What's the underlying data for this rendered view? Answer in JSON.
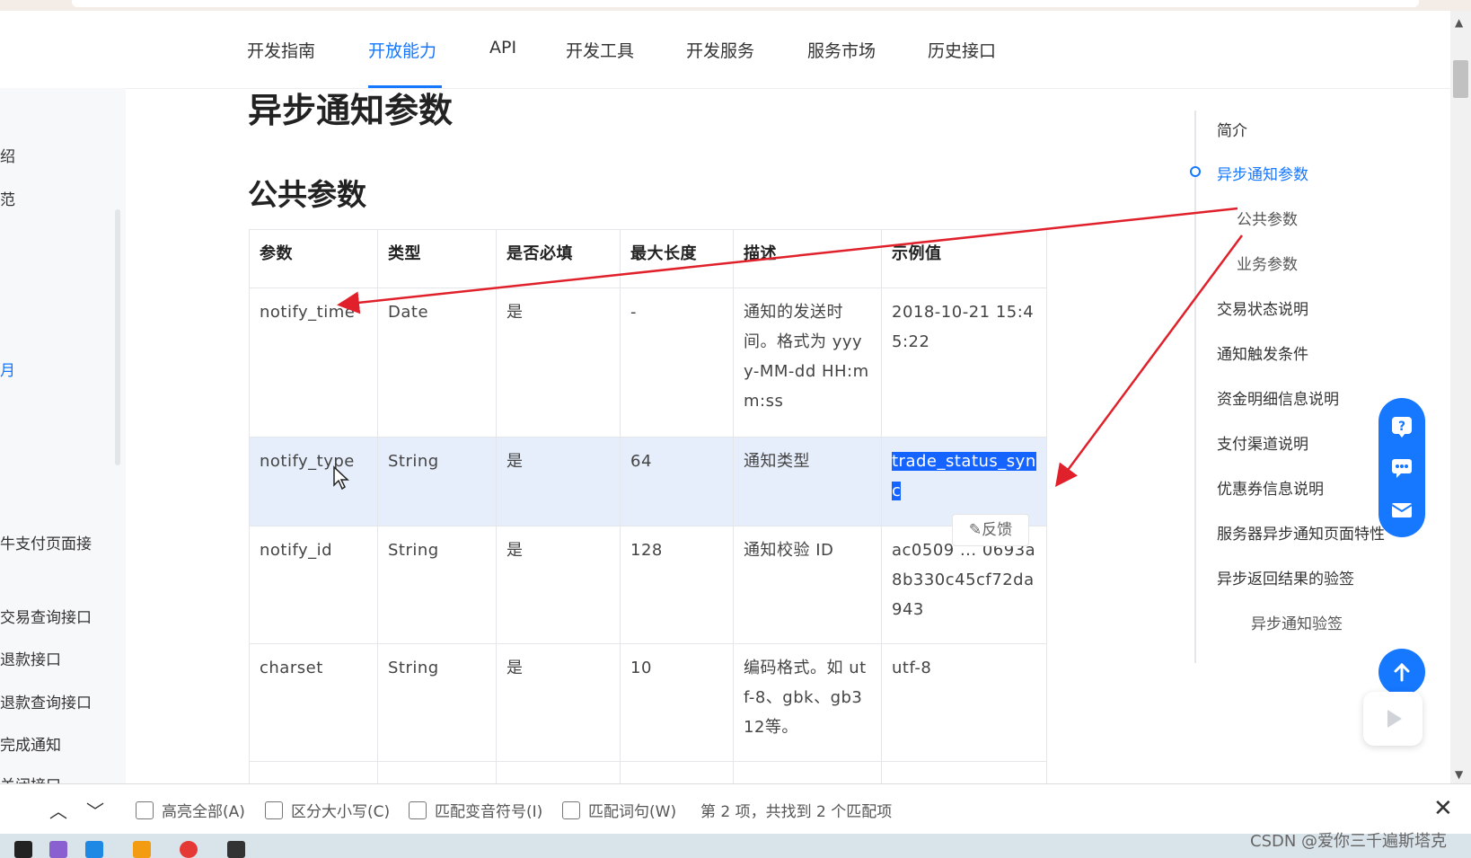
{
  "nav": {
    "items": [
      {
        "label": "开发指南",
        "active": false
      },
      {
        "label": "开放能力",
        "active": true
      },
      {
        "label": "API",
        "active": false
      },
      {
        "label": "开发工具",
        "active": false
      },
      {
        "label": "开发服务",
        "active": false
      },
      {
        "label": "服务市场",
        "active": false
      },
      {
        "label": "历史接口",
        "active": false
      }
    ]
  },
  "sidebar": {
    "items": [
      "绍",
      "范",
      "月",
      "牛支付页面接",
      "交易查询接口",
      "退款接口",
      "退款查询接口",
      "完成通知",
      "关闭接口"
    ]
  },
  "content": {
    "title": "异步通知参数",
    "section": "公共参数",
    "table": {
      "headers": [
        "参数",
        "类型",
        "是否必填",
        "最大长度",
        "描述",
        "示例值"
      ],
      "rows": [
        {
          "param": "notify_time",
          "type": "Date",
          "required": "是",
          "maxlen": "-",
          "desc": "通知的发送时间。格式为 yyyy-MM-dd HH:mm:ss",
          "example": "2018-10-21 15:45:22"
        },
        {
          "param": "notify_type",
          "type": "String",
          "required": "是",
          "maxlen": "64",
          "desc": "通知类型",
          "example": "trade_status_sync"
        },
        {
          "param": "notify_id",
          "type": "String",
          "required": "是",
          "maxlen": "128",
          "desc": "通知校验 ID",
          "example": "ac0509 ... 0693a8b330c45cf72da943"
        },
        {
          "param": "charset",
          "type": "String",
          "required": "是",
          "maxlen": "10",
          "desc": "编码格式。如 utf-8、gbk、gb312等。",
          "example": "utf-8"
        }
      ]
    },
    "feedback_label": "反馈"
  },
  "toc": {
    "items": [
      {
        "label": "简介",
        "level": 1
      },
      {
        "label": "异步通知参数",
        "level": 1,
        "active": true
      },
      {
        "label": "公共参数",
        "level": 2
      },
      {
        "label": "业务参数",
        "level": 2
      },
      {
        "label": "交易状态说明",
        "level": 1
      },
      {
        "label": "通知触发条件",
        "level": 1
      },
      {
        "label": "资金明细信息说明",
        "level": 1
      },
      {
        "label": "支付渠道说明",
        "level": 1
      },
      {
        "label": "优惠券信息说明",
        "level": 1
      },
      {
        "label": "服务器异步通知页面特性",
        "level": 1
      },
      {
        "label": "异步返回结果的验签",
        "level": 1
      },
      {
        "label": "异步通知验签",
        "level": 3
      }
    ]
  },
  "findbar": {
    "options": [
      "高亮全部(A)",
      "区分大小写(C)",
      "匹配变音符号(I)",
      "匹配词句(W)"
    ],
    "status": "第 2 项，共找到 2 个匹配项"
  },
  "watermark": "CSDN @爱你三千遍斯塔克",
  "colors": {
    "accent": "#1677ff",
    "annotation": "#e0202a",
    "selection": "#1664ff"
  }
}
